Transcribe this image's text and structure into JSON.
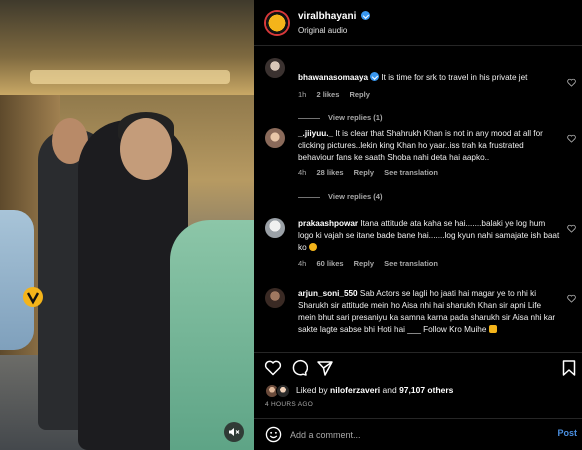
{
  "post": {
    "username": "viralbhayani",
    "audio": "Original audio"
  },
  "comments": [
    {
      "username": "bhawanasomaaya",
      "verified": true,
      "text": "It is time for srk to travel in his private jet",
      "time": "1h",
      "likes": "2 likes",
      "reply": "Reply",
      "view_replies": "View replies (1)"
    },
    {
      "username": "_.jiiyuu._",
      "text": "It is clear that Shahrukh Khan is not in any mood at all for clicking pictures..lekin king Khan ho yaar..iss trah ka frustrated behaviour fans ke saath Shoba nahi deta hai aapko..",
      "time": "4h",
      "likes": "28 likes",
      "reply": "Reply",
      "translation": "See translation",
      "view_replies": "View replies (4)"
    },
    {
      "username": "prakaashpowar",
      "text": "Itana attitude ata kaha se hai.......balaki ye log hum logo ki vajah se itane bade bane hai.......log kyun nahi samajate ish baat ko",
      "time": "4h",
      "likes": "60 likes",
      "reply": "Reply",
      "translation": "See translation"
    },
    {
      "username": "arjun_soni_550",
      "text": "Sab Actors se lagli ho jaati hai magar ye to nhi ki Sharukh sir attitude mein ho Aisa nhi hai sharukh Khan sir apni Life mein bhut sari presaniyu ka samna karna pada sharukh sir Aisa nhi kar sakte lagte sabse bhi Hoti hai ___ Follow Kro Muihe"
    }
  ],
  "likes": {
    "liked_by_prefix": "Liked by",
    "liked_by_user": "niloferzaveri",
    "and": "and",
    "count": "97,107 others"
  },
  "time_ago": "4 HOURS AGO",
  "composer": {
    "placeholder": "Add a comment...",
    "post_label": "Post"
  },
  "icons": {
    "like": "heart-icon",
    "comment": "comment-icon",
    "share": "share-icon",
    "save": "bookmark-icon",
    "emoji": "emoji-icon",
    "mute": "speaker-muted-icon"
  },
  "colors": {
    "background": "#000000",
    "verified": "#3897f0",
    "post_button": "#4a8fe0",
    "muted_text": "#a8a8a8"
  }
}
